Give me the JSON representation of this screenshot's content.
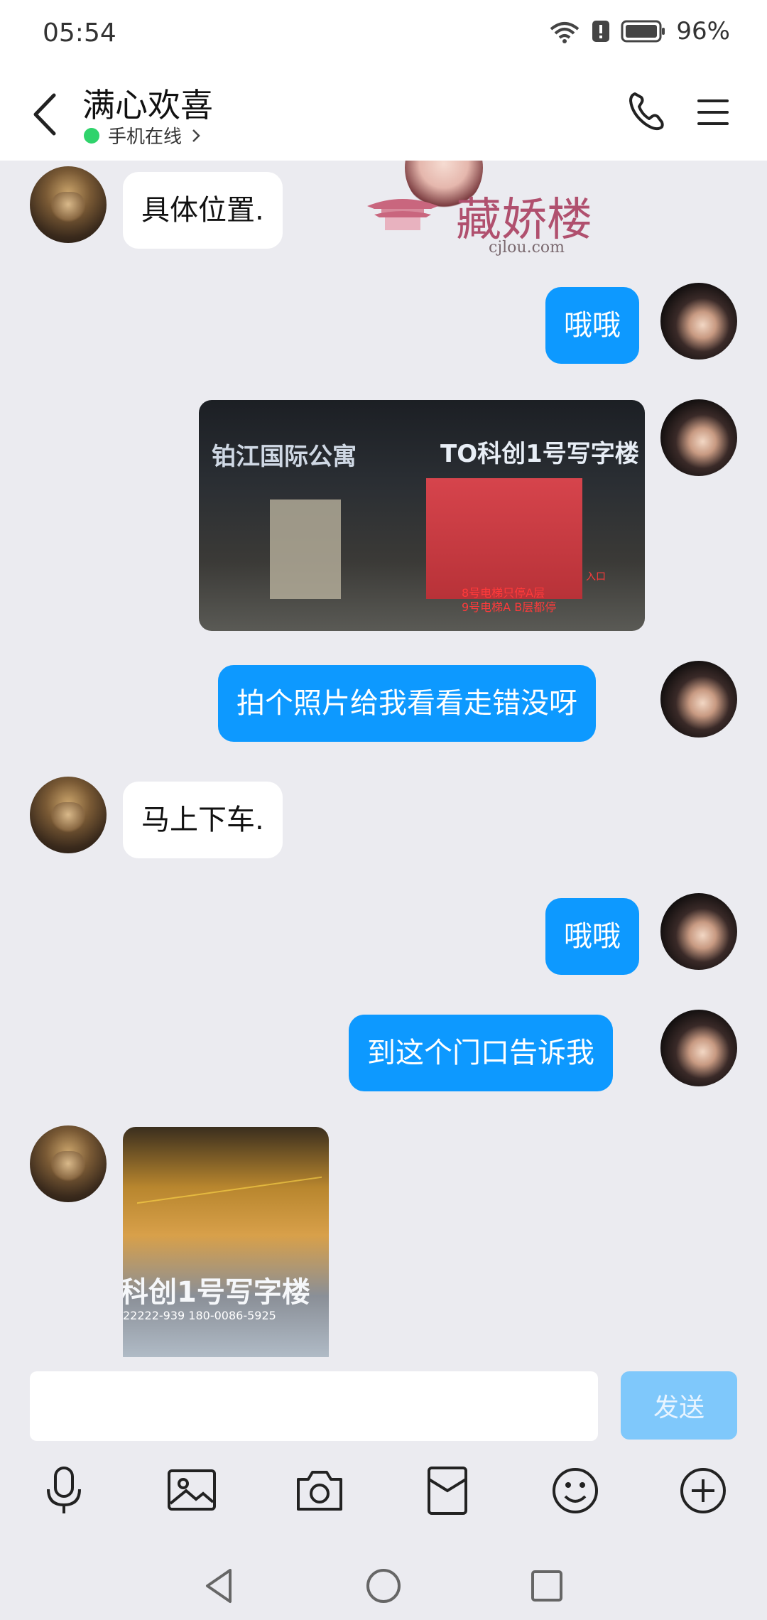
{
  "status_bar": {
    "time": "05:54",
    "battery_percent": "96%",
    "icons": [
      "wifi-icon",
      "alert-icon",
      "battery-icon"
    ]
  },
  "header": {
    "title": "满心欢喜",
    "status": "手机在线",
    "status_color": "#2fd36b"
  },
  "messages": [
    {
      "side": "in",
      "type": "text",
      "text": "具体位置."
    },
    {
      "side": "out",
      "type": "text",
      "text": "哦哦"
    },
    {
      "side": "out",
      "type": "image",
      "image_text": {
        "sign_left": "铂江国际公寓",
        "sign_right": "TO科创1号写字楼",
        "note": "8号电梯只停A层\n9号电梯A B层都停",
        "note_entrance": "入口"
      }
    },
    {
      "side": "out",
      "type": "text",
      "text": "拍个照片给我看看走错没呀"
    },
    {
      "side": "in",
      "type": "text",
      "text": "马上下车."
    },
    {
      "side": "out",
      "type": "text",
      "text": "哦哦"
    },
    {
      "side": "out",
      "type": "text",
      "text": "到这个门口告诉我"
    },
    {
      "side": "in",
      "type": "image",
      "image_text": {
        "sign": "科创1号写字楼",
        "phone": "22222-939 180-0086-5925"
      }
    }
  ],
  "watermark": {
    "text": "藏娇楼",
    "url": "cjlou.com"
  },
  "composer": {
    "input_value": "",
    "send_label": "发送"
  },
  "colors": {
    "accent": "#0d99ff",
    "send_disabled": "#7fc8fb",
    "background": "#ebebf0"
  }
}
